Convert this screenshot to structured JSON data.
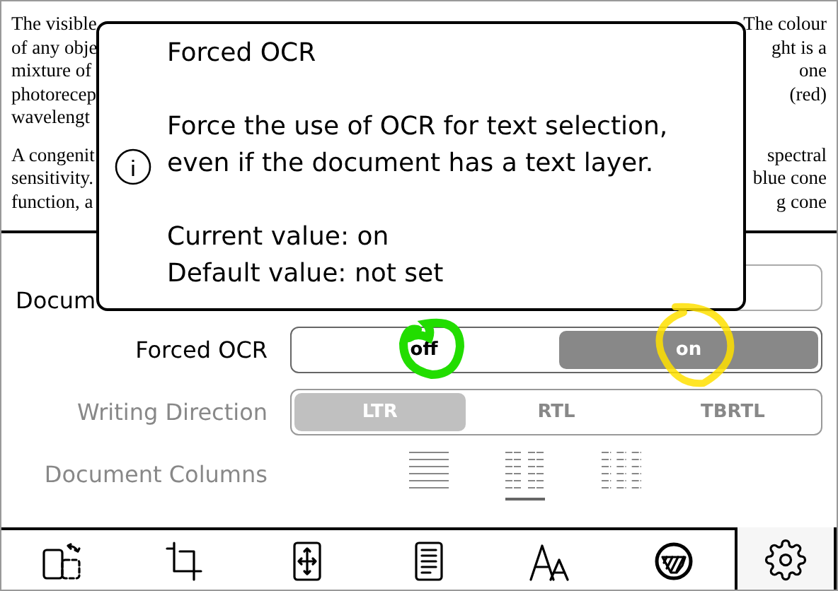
{
  "document": {
    "paragraphs": [
      {
        "lines": [
          {
            "left": "The visible",
            "right": "The colour"
          },
          {
            "left": "of any obje",
            "right": "ght is a"
          },
          {
            "left": "mixture of",
            "right": "one"
          },
          {
            "left": "photorecep",
            "right": "(red)"
          },
          {
            "left": "wavelengt"
          }
        ]
      },
      {
        "lines": [
          {
            "left": "A congenit",
            "right": "spectral"
          },
          {
            "left": "sensitivity.",
            "right": "blue cone"
          },
          {
            "left": "function, a",
            "right": "g cone"
          }
        ]
      }
    ]
  },
  "popup": {
    "title": "Forced OCR",
    "body": [
      "Force the use of OCR for text selection,",
      "even if the document has a text layer."
    ],
    "current": "Current value: on",
    "default": "Default value: not set"
  },
  "settings": [
    {
      "kind": "field",
      "label": "Docum",
      "disabled": false
    },
    {
      "kind": "toggle",
      "label": "Forced OCR",
      "disabled": false,
      "options": [
        {
          "label": "off",
          "selected": false
        },
        {
          "label": "on",
          "selected": true
        }
      ]
    },
    {
      "kind": "toggle",
      "label": "Writing Direction",
      "disabled": true,
      "options": [
        {
          "label": "LTR",
          "selected": true
        },
        {
          "label": "RTL",
          "selected": false
        },
        {
          "label": "TBRTL",
          "selected": false
        }
      ]
    },
    {
      "kind": "columns",
      "label": "Document Columns",
      "disabled": true,
      "options": [
        {
          "kind": "one",
          "selected": false
        },
        {
          "kind": "two",
          "selected": true
        },
        {
          "kind": "three",
          "selected": false
        }
      ]
    }
  ],
  "toolbar": [
    {
      "kind": "rotate",
      "selected": false
    },
    {
      "kind": "crop",
      "selected": false
    },
    {
      "kind": "fit",
      "selected": false
    },
    {
      "kind": "page",
      "selected": false
    },
    {
      "kind": "font",
      "selected": false
    },
    {
      "kind": "contrast",
      "selected": false
    },
    {
      "kind": "settings",
      "selected": true
    }
  ]
}
